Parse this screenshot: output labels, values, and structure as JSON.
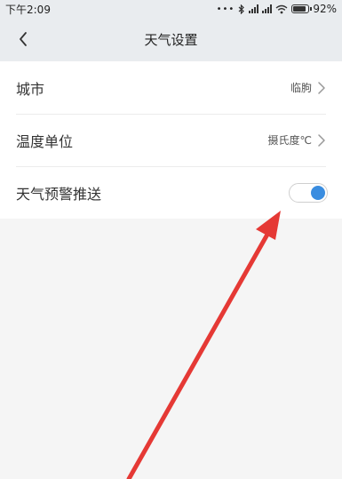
{
  "status_bar": {
    "time": "下午2:09",
    "battery": "92%",
    "battery_level": 0.92,
    "icons": [
      "more-dots-icon",
      "bluetooth-icon",
      "signal-icon",
      "signal-icon",
      "wifi-icon",
      "battery-icon"
    ]
  },
  "header": {
    "title": "天气设置",
    "back_icon": "chevron-left-icon"
  },
  "settings": [
    {
      "label": "城市",
      "value": "临朐",
      "type": "link"
    },
    {
      "label": "温度单位",
      "value": "摄氏度℃",
      "type": "link"
    },
    {
      "label": "天气预警推送",
      "type": "toggle",
      "enabled": true
    }
  ],
  "colors": {
    "accent": "#3a8de0",
    "annotation_arrow": "#e53935",
    "header_bg": "#e9ecef"
  }
}
